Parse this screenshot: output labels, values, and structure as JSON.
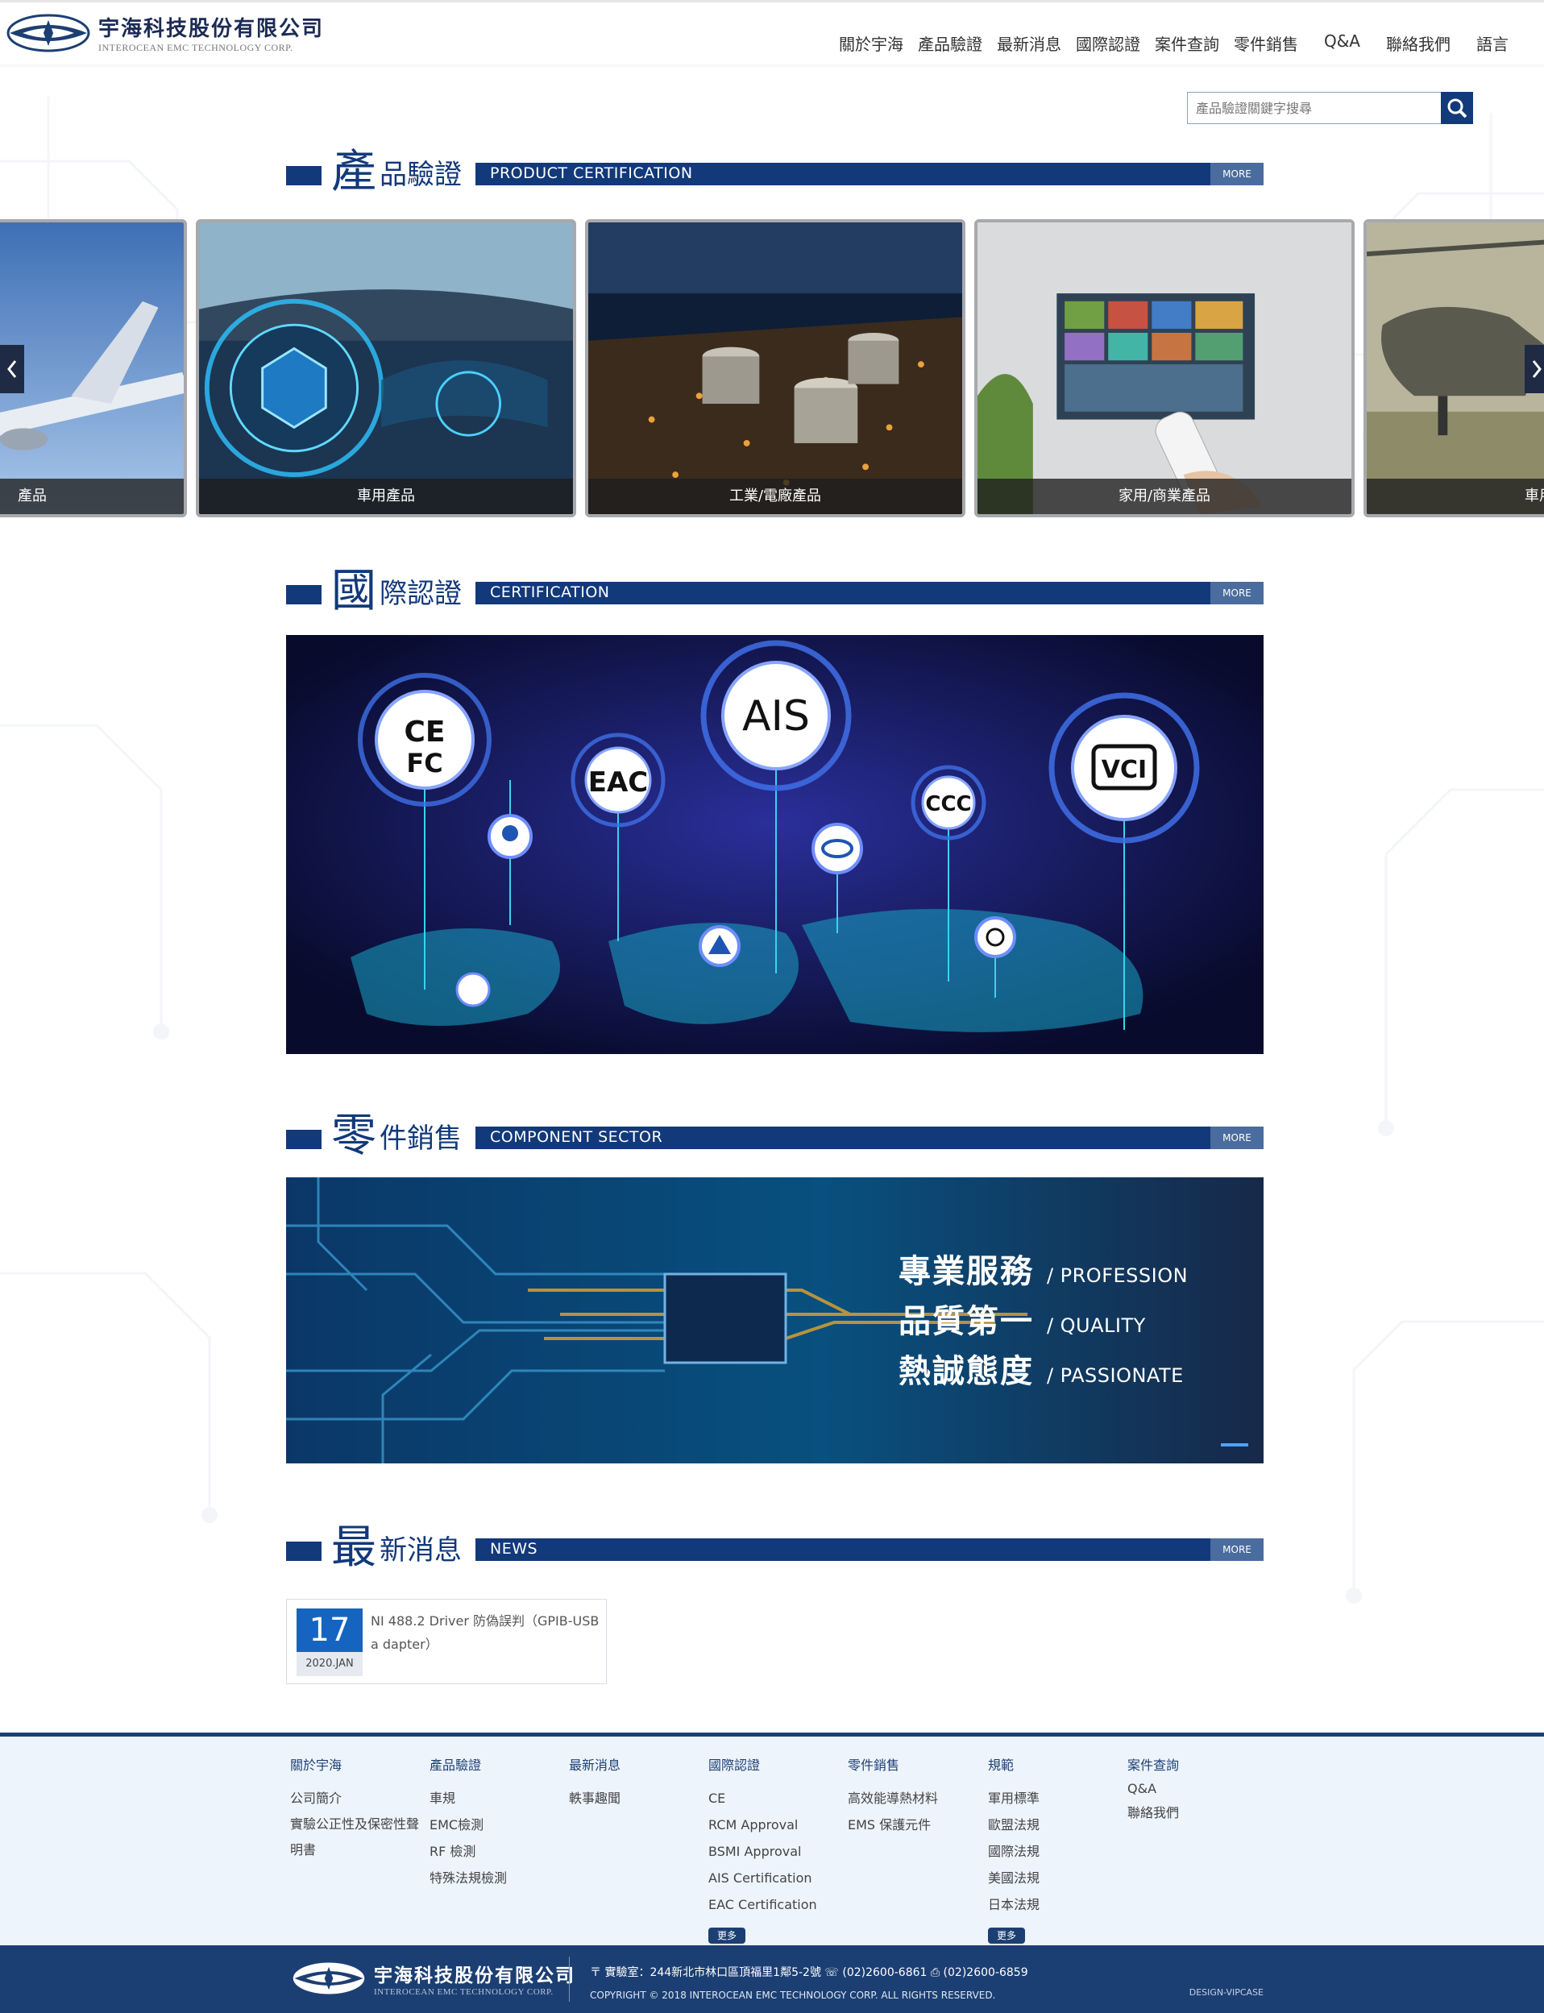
{
  "header": {
    "company_name": "宇海科技股份有限公司",
    "company_sub": "INTEROCEAN EMC TECHNOLOGY CORP.",
    "nav": [
      "關於宇海",
      "產品驗證",
      "最新消息",
      "國際認證",
      "案件查詢",
      "零件銷售",
      "Q&A",
      "聯絡我們",
      "語言"
    ]
  },
  "search": {
    "placeholder": "產品驗證關鍵字搜尋",
    "icon": "search-icon"
  },
  "sections": {
    "product": {
      "big": "產",
      "small": "品驗證",
      "en": "PRODUCT CERTIFICATION",
      "more": "MORE"
    },
    "cert": {
      "big": "國",
      "small": "際認證",
      "en": "CERTIFICATION",
      "more": "MORE"
    },
    "component": {
      "big": "零",
      "small": "件銷售",
      "en": "COMPONENT SECTOR",
      "more": "MORE"
    },
    "news": {
      "big": "最",
      "small": "新消息",
      "en": "NEWS",
      "more": "MORE"
    }
  },
  "carousel": {
    "items": [
      "產品",
      "車用產品",
      "工業/電廠產品",
      "家用/商業產品",
      "車用"
    ],
    "prev_icon": "chevron-left-icon",
    "next_icon": "chevron-right-icon"
  },
  "cert_banner": {
    "ais": "AIS"
  },
  "component_banner": {
    "line1_zh": "專業服務",
    "line1_en": "/ PROFESSION",
    "line2_zh": "品質第一",
    "line2_en": "/ QUALITY",
    "line3_zh": "熱誠態度",
    "line3_en": "/ PASSIONATE"
  },
  "news": {
    "items": [
      {
        "day": "17",
        "month": "2020.JAN",
        "title": "NI 488.2 Driver 防偽誤判（GPIB-USB a dapter）"
      }
    ]
  },
  "footer": {
    "columns": [
      {
        "head": "關於宇海",
        "links": [
          "公司簡介",
          "實驗公正性及保密性聲明書"
        ]
      },
      {
        "head": "產品驗證",
        "links": [
          "車規",
          "EMC檢測",
          "RF 檢測",
          "特殊法規檢測"
        ]
      },
      {
        "head": "最新消息",
        "links": [
          "軼事趣聞"
        ]
      },
      {
        "head": "國際認證",
        "links": [
          "CE",
          "RCM Approval",
          "BSMI Approval",
          "AIS Certification",
          "EAC Certification"
        ],
        "more": "更多"
      },
      {
        "head": "零件銷售",
        "links": [
          "高效能導熱材料",
          "EMS 保護元件"
        ]
      },
      {
        "head": "規範",
        "links": [
          "軍用標準",
          "歐盟法規",
          "國際法規",
          "美國法規",
          "日本法規"
        ],
        "more": "更多"
      },
      {
        "head": "案件查詢",
        "links": [
          "Q&A",
          "聯絡我們"
        ]
      }
    ]
  },
  "bottom": {
    "address": "實驗室：244新北市林口區頂福里1鄰5-2號",
    "phone": "(02)2600-6861",
    "fax": "(02)2600-6859",
    "copyright": "COPYRIGHT © 2018 INTEROCEAN EMC TECHNOLOGY CORP. ALL RIGHTS RESERVED.",
    "design": "DESIGN-VIPCASE"
  },
  "colors": {
    "brand": "#12397a",
    "footer": "#1c3f73",
    "news_day": "#1565c0"
  }
}
